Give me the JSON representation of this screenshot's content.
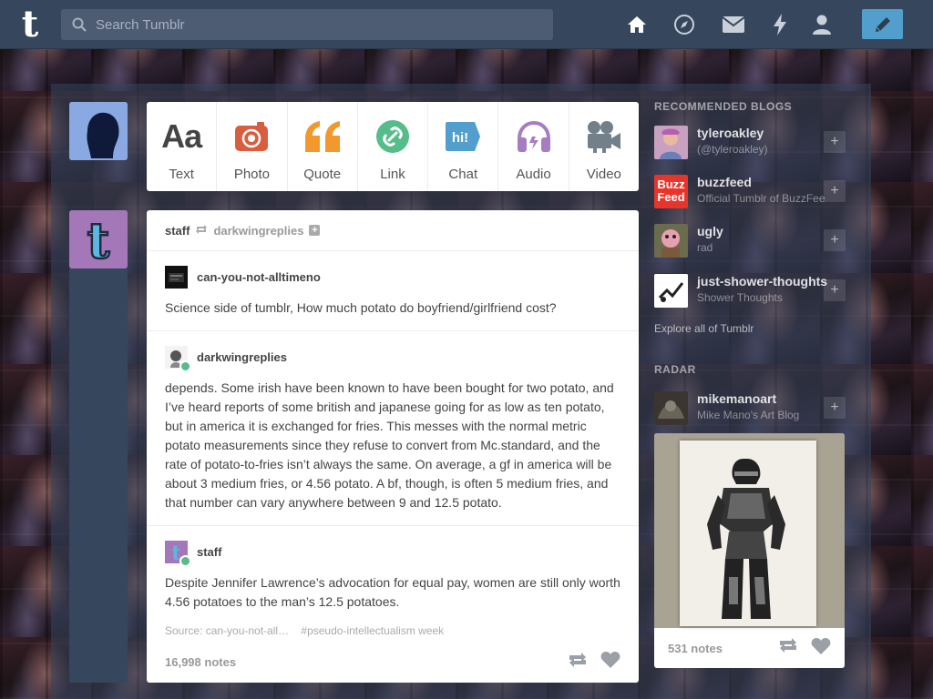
{
  "topbar": {
    "logo": "t",
    "search_placeholder": "Search Tumblr",
    "nav_icons": [
      "home-icon",
      "explore-compass-icon",
      "inbox-envelope-icon",
      "activity-lightning-icon",
      "account-person-icon"
    ],
    "compose_icon": "pencil-icon"
  },
  "post_types": [
    {
      "label": "Text",
      "glyph": "Aa",
      "color": "#444444"
    },
    {
      "label": "Photo",
      "color": "#d95e40"
    },
    {
      "label": "Quote",
      "glyph": "❝",
      "color": "#f2992e"
    },
    {
      "label": "Link",
      "color": "#56bc8a"
    },
    {
      "label": "Chat",
      "glyph": "hi!",
      "color": "#529ecc"
    },
    {
      "label": "Audio",
      "color": "#a77dc2"
    },
    {
      "label": "Video",
      "color": "#748089"
    }
  ],
  "post": {
    "author": "staff",
    "reblogged_from": "darkwingreplies",
    "thread": [
      {
        "name": "can-you-not-alltimeno",
        "text": "Science side of tumblr, How much potato do boyfriend/girlfriend cost?"
      },
      {
        "name": "darkwingreplies",
        "text": "depends. Some irish have been known to have been bought for two potato, and I’ve heard reports of some british and japanese going for as low as ten potato, but in america it is exchanged for fries. This messes with the normal metric potato measurements since they refuse to convert from Mc.standard, and the rate of potato-to-fries isn’t always the same. On average, a gf in america will be about 3 medium fries, or 4.56 potato. A bf, though, is often 5 medium fries, and that number can vary anywhere between 9 and 12.5 potato."
      },
      {
        "name": "staff",
        "text": "Despite Jennifer Lawrence’s advocation for equal pay, women are still only worth 4.56 potatoes to the man’s 12.5 potatoes."
      }
    ],
    "source": "Source: can-you-not-all…",
    "tag": "#pseudo-intellectualism week",
    "notes": "16,998 notes"
  },
  "sidebar": {
    "recommended_heading": "RECOMMENDED BLOGS",
    "blogs": [
      {
        "name": "tyleroakley",
        "sub": "(@tyleroakley)"
      },
      {
        "name": "buzzfeed",
        "sub": "Official Tumblr of BuzzFeed",
        "avatar_text": "Buzz Feed"
      },
      {
        "name": "ugly",
        "sub": "rad"
      },
      {
        "name": "just-shower-thoughts",
        "sub": "Shower Thoughts"
      }
    ],
    "explore": "Explore all of Tumblr",
    "radar_heading": "RADAR",
    "radar": {
      "name": "mikemanoart",
      "sub": "Mike Mano's Art Blog",
      "notes": "531 notes"
    }
  }
}
